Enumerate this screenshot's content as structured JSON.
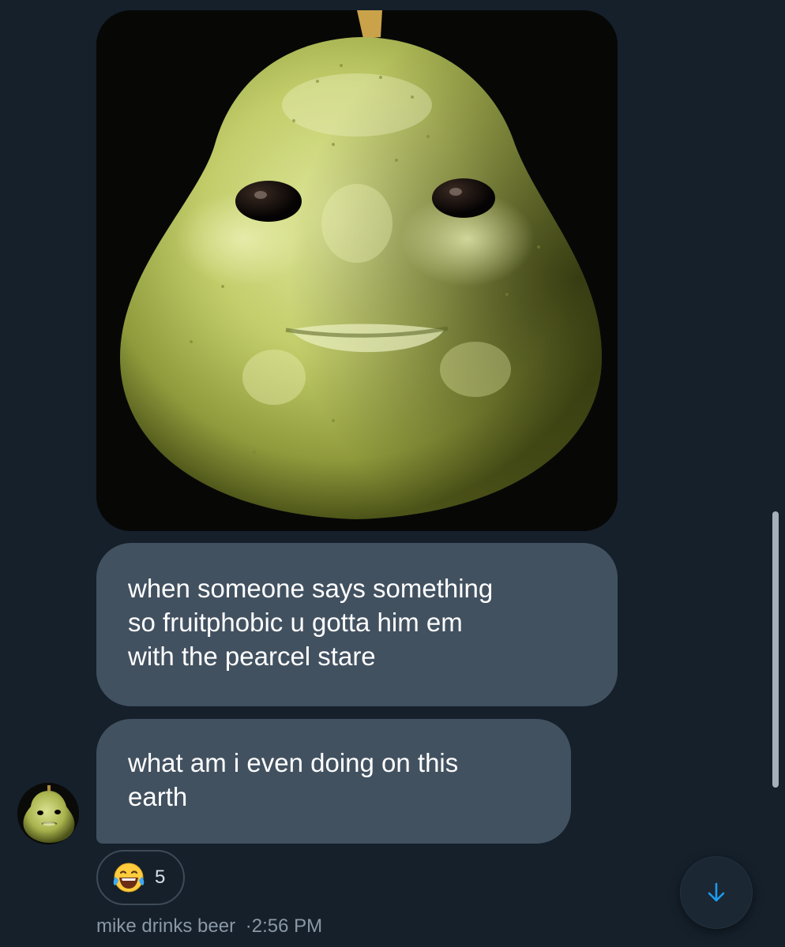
{
  "conversation": {
    "messages": [
      {
        "line1": "when someone says something",
        "line2": "so fruitphobic u gotta him em",
        "line3": "with the pearcel stare"
      },
      {
        "line1": "what am i even doing on this",
        "line2": "earth"
      }
    ],
    "reaction": {
      "emoji": "laughing-tears-icon",
      "count": "5"
    },
    "meta": {
      "sender": "mike drinks beer",
      "separator": "·",
      "time": "2:56 PM"
    }
  },
  "colors": {
    "background": "#15202b",
    "bubble": "#425160",
    "meta_text": "#8b98a5",
    "accent": "#1d9bf0"
  },
  "icons": {
    "scroll_button": "arrow-down-icon"
  }
}
